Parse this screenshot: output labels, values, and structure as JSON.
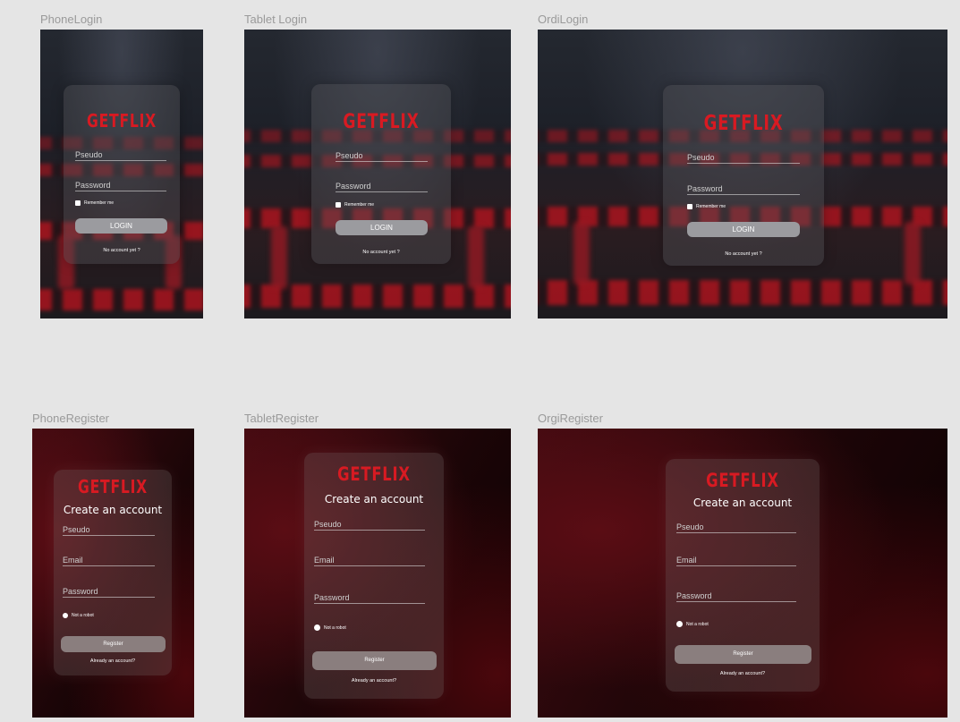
{
  "frames": {
    "phone_login": "PhoneLogin",
    "tablet_login": "Tablet Login",
    "desktop_login": "OrdiLogin",
    "phone_register": "PhoneRegister",
    "tablet_register": "TabletRegister",
    "desktop_register": "OrgiRegister"
  },
  "login": {
    "logo": "GETFLIX",
    "pseudo_placeholder": "Pseudo",
    "password_placeholder": "Password",
    "remember_label": "Remember me",
    "login_button": "LOGIN",
    "no_account_link": "No account yet ?"
  },
  "register": {
    "logo": "GETFLIX",
    "title": "Create an account",
    "pseudo_placeholder": "Pseudo",
    "email_placeholder": "Email",
    "password_placeholder": "Password",
    "robot_label": "Not a robot",
    "register_button": "Register",
    "already_account_link": "Already an account?"
  },
  "colors": {
    "brand_red": "#d81a22",
    "canvas": "#e5e5e5"
  }
}
